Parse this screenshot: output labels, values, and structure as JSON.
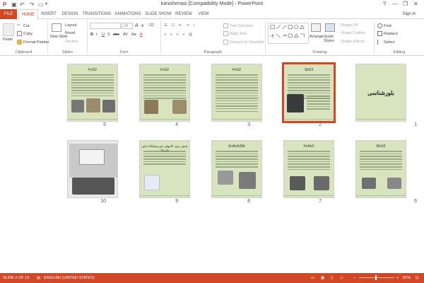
{
  "window": {
    "title": "kanishenasi [Compatibility Mode] - PowerPoint",
    "help": "?",
    "controls": {
      "minimize": "—",
      "restore": "❐",
      "close": "✕"
    },
    "sign_in": "Sign in"
  },
  "tabs": [
    "FILE",
    "HOME",
    "INSERT",
    "DESIGN",
    "TRANSITIONS",
    "ANIMATIONS",
    "SLIDE SHOW",
    "REVIEW",
    "VIEW"
  ],
  "ribbon": {
    "clipboard": {
      "label": "Clipboard",
      "paste": "Paste",
      "cut": "Cut",
      "copy": "Copy",
      "format_painter": "Format Painter"
    },
    "slides": {
      "label": "Slides",
      "new_slide": "New Slide",
      "layout": "Layout",
      "reset": "Reset",
      "section": "Section"
    },
    "font": {
      "label": "Font",
      "font_size": "24",
      "bold": "B",
      "italic": "I",
      "underline": "U",
      "strike": "S",
      "spacing": "AV",
      "case": "Aa",
      "color": "A",
      "grow": "A",
      "shrink": "A"
    },
    "paragraph": {
      "label": "Paragraph",
      "text_direction": "Text Direction",
      "align_text": "Align Text",
      "convert": "Convert to SmartArt"
    },
    "drawing": {
      "label": "Drawing",
      "arrange": "Arrange",
      "quick_styles": "Quick Styles",
      "shape_fill": "Shape Fill",
      "shape_outline": "Shape Outline",
      "shape_effects": "Shape Effects"
    },
    "editing": {
      "label": "Editing",
      "find": "Find",
      "replace": "Replace",
      "select": "Select"
    }
  },
  "slides": [
    {
      "number": "1",
      "title": "بلورشناسی",
      "selected": false
    },
    {
      "number": "2",
      "title": "SbS3",
      "selected": true
    },
    {
      "number": "3",
      "title": "FeS2",
      "selected": false
    },
    {
      "number": "4",
      "title": "FeS2",
      "selected": false
    },
    {
      "number": "5",
      "title": "FeS2",
      "selected": false
    },
    {
      "number": "6",
      "title": "MoS2",
      "selected": false
    },
    {
      "number": "7",
      "title": "FeAsS",
      "selected": false
    },
    {
      "number": "8",
      "title": "SnAsSdSb",
      "selected": false
    },
    {
      "number": "9",
      "title": "بخش دوم: کانیهای غیرسیلیکاته (غیر فلزها)",
      "selected": false
    },
    {
      "number": "10",
      "title": "",
      "selected": false
    }
  ],
  "status": {
    "slide_info": "SLIDE 2 OF 10",
    "language": "ENGLISH (UNITED STATES)",
    "zoom": "81%"
  },
  "colors": {
    "accent": "#d24726",
    "slide_bg": "#d7e4bd"
  }
}
